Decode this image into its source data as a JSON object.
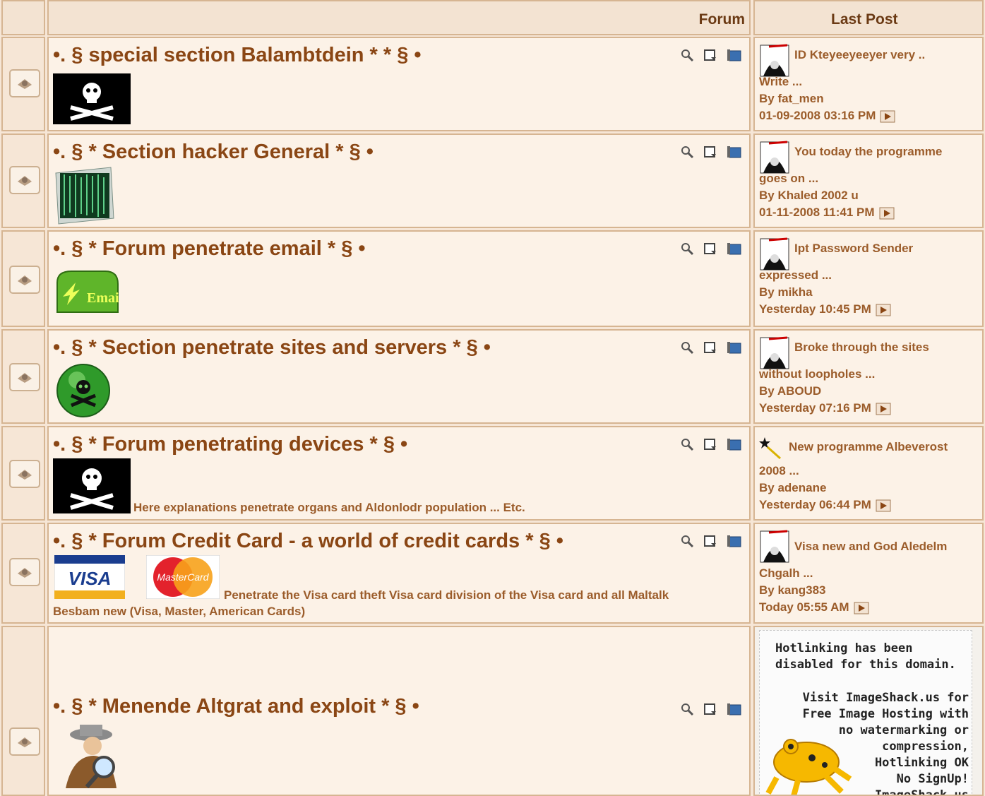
{
  "header": {
    "forum_label": "Forum",
    "last_post_label": "Last Post"
  },
  "forums": [
    {
      "title": "•. § special section Balambtdein * * § •",
      "icon": "skull-flag-icon",
      "description": "",
      "last_post": {
        "avatar": "reaper-avatar-icon",
        "topic": "ID Kteyeeyeeyer very ..",
        "topic_cont": "Write ...",
        "by": "By fat_men",
        "when": "01-09-2008 03:16 PM"
      }
    },
    {
      "title": "•. § * Section hacker General * § •",
      "icon": "matrix-folder-icon",
      "description": "",
      "last_post": {
        "avatar": "reaper-avatar-icon",
        "topic": "You today the programme",
        "topic_cont": "goes on ...",
        "by": "By Khaled 2002 u",
        "when": "01-11-2008 11:41 PM"
      }
    },
    {
      "title": "•. § * Forum penetrate email * § •",
      "icon": "email-mailbox-icon",
      "icon_text": "Email",
      "description": "",
      "last_post": {
        "avatar": "reaper-avatar-icon",
        "topic": "Ipt Password Sender",
        "topic_cont": "expressed ...",
        "by": "By mikha",
        "when": "Yesterday 10:45 PM"
      }
    },
    {
      "title": "•. § * Section penetrate sites and servers * § •",
      "icon": "green-skull-orb-icon",
      "description": "",
      "last_post": {
        "avatar": "reaper-avatar-icon",
        "topic": "Broke through the sites",
        "topic_cont": "without loopholes ...",
        "by": "By ABOUD",
        "when": "Yesterday 07:16 PM"
      }
    },
    {
      "title": "•. § * Forum penetrating devices * § •",
      "icon": "skull-flag-icon",
      "description": "Here explanations penetrate organs and Aldonlodr population ... Etc.",
      "last_post": {
        "avatar": "star-wand-icon",
        "topic": "New programme Albeverost",
        "topic_cont": "2008 ...",
        "by": "By adenane",
        "when": "Yesterday 06:44 PM"
      }
    },
    {
      "title": "•. § * Forum Credit Card - a world of credit cards * § •",
      "icon": "credit-cards-icon",
      "visa_text": "VISA",
      "mc_text": "MasterCard",
      "description": "Penetrate the Visa card theft Visa card division of the Visa card and all Maltalk",
      "description2": "Besbam new (Visa, Master, American Cards)",
      "last_post": {
        "avatar": "reaper-avatar-icon",
        "topic": "Visa new and God Aledelm",
        "topic_cont": "Chgalh ...",
        "by": "By kang383",
        "when": "Today 05:55 AM"
      }
    },
    {
      "title": "•. § * Menende Altgrat and exploit * § •",
      "icon": "spy-detective-icon",
      "description": "",
      "hotlink": [
        "Hotlinking has been",
        "disabled for this domain.",
        "Visit ImageShack.us for",
        "Free Image Hosting with",
        "no watermarking or",
        "compression,",
        "Hotlinking OK",
        "No SignUp!",
        "ImageShack.us"
      ]
    }
  ],
  "colors": {
    "accent": "#8a4614",
    "text": "#9b5c2a",
    "border": "#d6b592",
    "cell": "#fcf2e7"
  }
}
